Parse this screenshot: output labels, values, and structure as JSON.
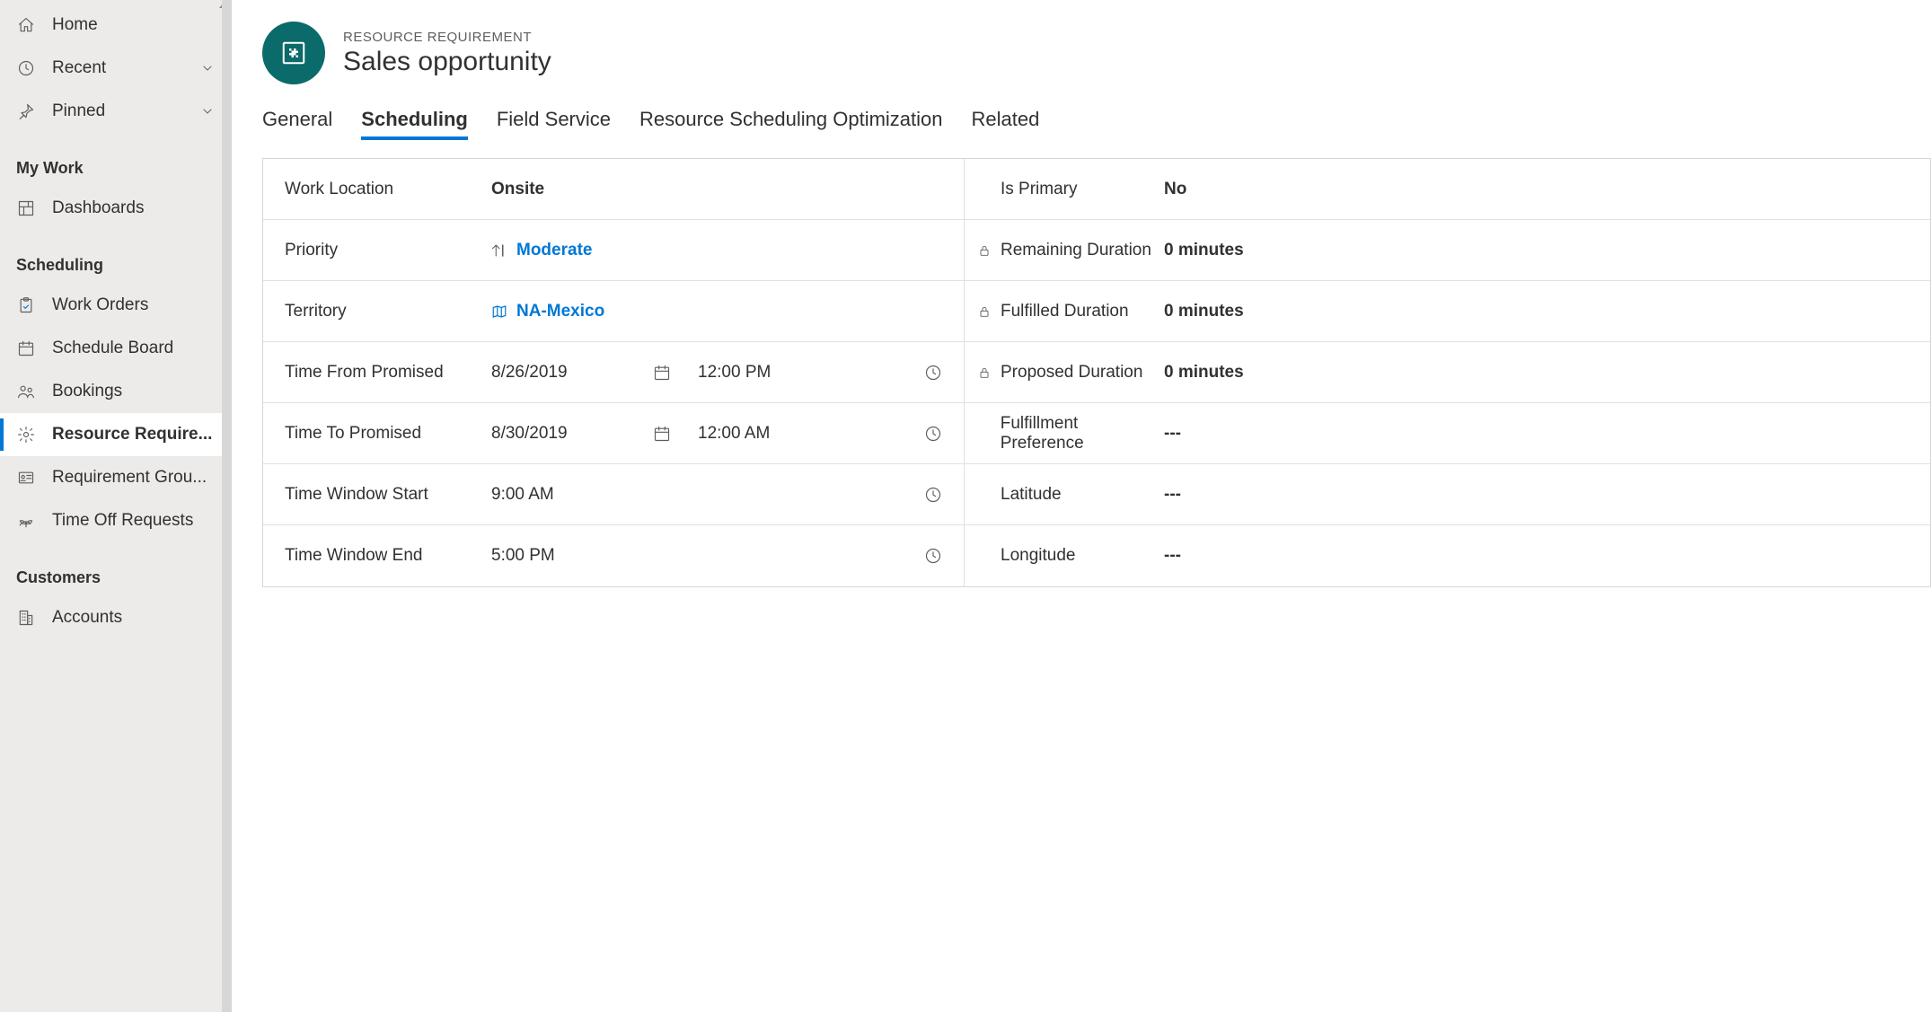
{
  "sidebar": {
    "top": [
      {
        "label": "Home",
        "icon": "home",
        "chevron": false
      },
      {
        "label": "Recent",
        "icon": "clock",
        "chevron": true
      },
      {
        "label": "Pinned",
        "icon": "pin",
        "chevron": true
      }
    ],
    "groups": [
      {
        "title": "My Work",
        "items": [
          {
            "label": "Dashboards",
            "icon": "dashboard"
          }
        ]
      },
      {
        "title": "Scheduling",
        "items": [
          {
            "label": "Work Orders",
            "icon": "clipboard"
          },
          {
            "label": "Schedule Board",
            "icon": "calendar"
          },
          {
            "label": "Bookings",
            "icon": "people"
          },
          {
            "label": "Resource Require...",
            "icon": "gear",
            "selected": true
          },
          {
            "label": "Requirement Grou...",
            "icon": "card"
          },
          {
            "label": "Time Off Requests",
            "icon": "timeoff"
          }
        ]
      },
      {
        "title": "Customers",
        "items": [
          {
            "label": "Accounts",
            "icon": "building"
          }
        ]
      }
    ]
  },
  "header": {
    "entity_type": "RESOURCE REQUIREMENT",
    "title": "Sales opportunity"
  },
  "tabs": [
    {
      "label": "General",
      "active": false
    },
    {
      "label": "Scheduling",
      "active": true
    },
    {
      "label": "Field Service",
      "active": false
    },
    {
      "label": "Resource Scheduling Optimization",
      "active": false
    },
    {
      "label": "Related",
      "active": false
    }
  ],
  "form": {
    "left": [
      {
        "label": "Work Location",
        "type": "text-bold",
        "value": "Onsite"
      },
      {
        "label": "Priority",
        "type": "lookup",
        "icon": "priority",
        "value": "Moderate"
      },
      {
        "label": "Territory",
        "type": "lookup",
        "icon": "map",
        "value": "NA-Mexico"
      },
      {
        "label": "Time From Promised",
        "type": "datetime",
        "date": "8/26/2019",
        "time": "12:00 PM"
      },
      {
        "label": "Time To Promised",
        "type": "datetime",
        "date": "8/30/2019",
        "time": "12:00 AM"
      },
      {
        "label": "Time Window Start",
        "type": "time",
        "time": "9:00 AM"
      },
      {
        "label": "Time Window End",
        "type": "time",
        "time": "5:00 PM"
      }
    ],
    "right": [
      {
        "label": "Is Primary",
        "locked": false,
        "value": "No"
      },
      {
        "label": "Remaining Duration",
        "locked": true,
        "value": "0 minutes"
      },
      {
        "label": "Fulfilled Duration",
        "locked": true,
        "value": "0 minutes"
      },
      {
        "label": "Proposed Duration",
        "locked": true,
        "value": "0 minutes"
      },
      {
        "label": "Fulfillment Preference",
        "locked": false,
        "value": "---"
      },
      {
        "label": "Latitude",
        "locked": false,
        "value": "---"
      },
      {
        "label": "Longitude",
        "locked": false,
        "value": "---"
      }
    ]
  }
}
